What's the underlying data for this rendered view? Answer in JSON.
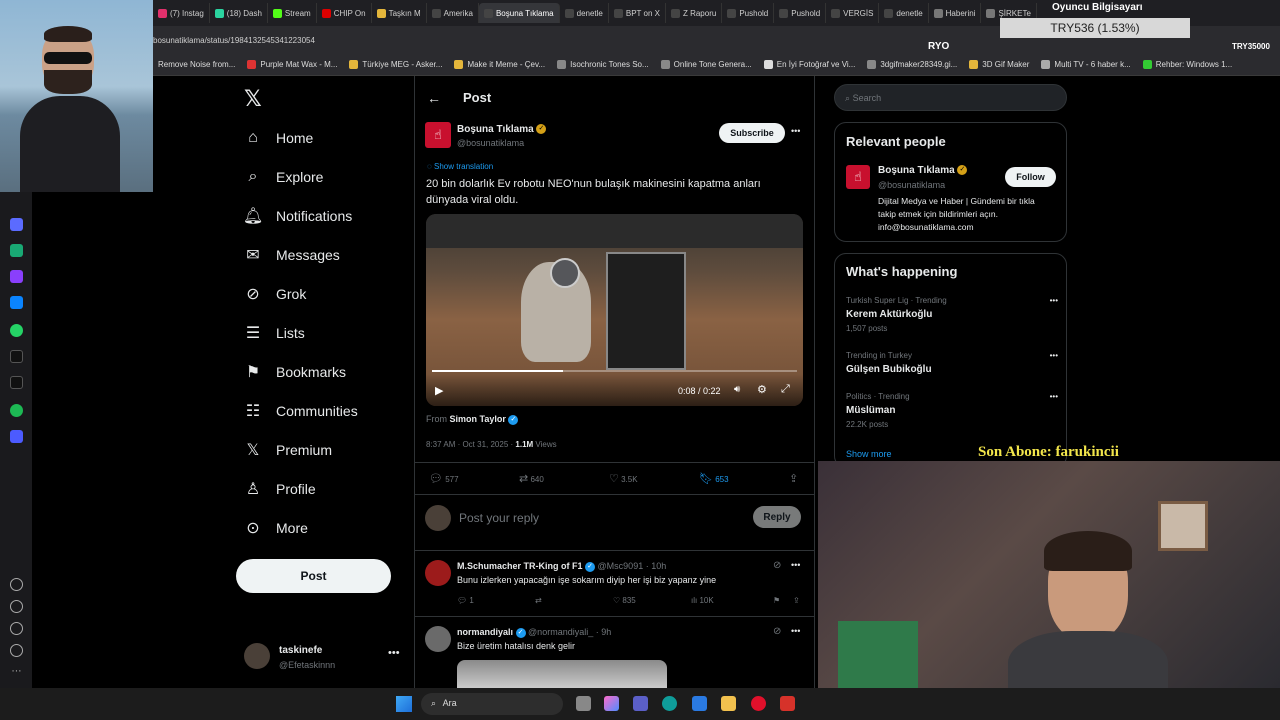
{
  "browser": {
    "tabs": [
      "(7) Instag",
      "(18) Dash",
      "Stream",
      "CHIP On",
      "Taşkın M",
      "Amerika",
      "Boşuna Tıklama",
      "denetle",
      "BPT on X",
      "Z Raporu",
      "Pushold",
      "Pushold",
      "VERGİS",
      "denetle",
      "Haberini",
      "ŞİRKETe",
      "Oyuncu Bilgisayarı"
    ],
    "url": "bosunatiklama/status/1984132545341223054",
    "bookmarks": [
      "Remove Noise from...",
      "Purple Mat Wax - M...",
      "Türkiye MEG - Asker...",
      "Make it Meme - Çev...",
      "Isochronic Tones So...",
      "Online Tone Genera...",
      "En İyi Fotoğraf ve Vi...",
      "3dgifmaker28349.gi...",
      "3D Gif Maker",
      "Multi TV - 6 haber k...",
      "Rehber: Windows 1..."
    ]
  },
  "overlay": {
    "price": "TRY536 (1.53%)",
    "ticker_left": "RYO",
    "ticker_right": "TRY35000",
    "son_abone": "Son Abone: farukincii"
  },
  "nav": {
    "items": [
      "Home",
      "Explore",
      "Notifications",
      "Messages",
      "Grok",
      "Lists",
      "Bookmarks",
      "Communities",
      "Premium",
      "Profile",
      "More"
    ],
    "post_button": "Post",
    "account": {
      "name": "taskinefe",
      "handle": "@Efetaskinnn"
    }
  },
  "post": {
    "header_title": "Post",
    "author_name": "Boşuna Tıklama",
    "author_handle": "@bosunatiklama",
    "subscribe": "Subscribe",
    "show_translation": "Show translation",
    "text": "20 bin dolarlık Ev robotu NEO'nun bulaşık makinesini kapatma anları dünyada viral oldu.",
    "video_time": "0:08 / 0:22",
    "video_progress": 0.36,
    "from_label": "From",
    "from_name": "Simon Taylor",
    "timestamp": "8:37 AM · Oct 31, 2025 · ",
    "views_count": "1.1M",
    "views_label": "Views",
    "replies": "577",
    "reposts": "640",
    "likes": "3.5K",
    "bookmarks": "653",
    "reply_placeholder": "Post your reply",
    "reply_button": "Reply"
  },
  "replies": [
    {
      "name": "M.Schumacher TR-King of F1",
      "handle": "@Msc9091 · 10h",
      "text": "Bunu izlerken yapacağın işe sokarım diyip her işi biz yapanz yine",
      "replies": "1",
      "likes": "835",
      "views": "10K"
    },
    {
      "name": "normandiyalı",
      "handle": "@normandiyali_ · 9h",
      "text": "Bize üretim hatalısı denk gelir"
    }
  ],
  "sidebar": {
    "search_placeholder": "Search",
    "relevant_title": "Relevant people",
    "relevant": {
      "name": "Boşuna Tıklama",
      "handle": "@bosunatiklama",
      "follow": "Follow",
      "bio": "Dijital Medya ve Haber | Gündemi bir tıkla takip etmek için bildirimleri açın. info@bosunatiklama.com"
    },
    "happening_title": "What's happening",
    "trends": [
      {
        "context": "Turkish Super Lig · Trending",
        "name": "Kerem Aktürkoğlu",
        "count": "1,507 posts"
      },
      {
        "context": "Trending in Turkey",
        "name": "Gülşen Bubikoğlu",
        "count": ""
      },
      {
        "context": "Politics · Trending",
        "name": "Müslüman",
        "count": "22.2K posts"
      }
    ],
    "show_more": "Show more"
  },
  "taskbar": {
    "search": "Ara"
  },
  "colors": {
    "accent": "#1d9bf0",
    "brand_red": "#c8102e",
    "bookmark_active": "#1d9bf0"
  }
}
